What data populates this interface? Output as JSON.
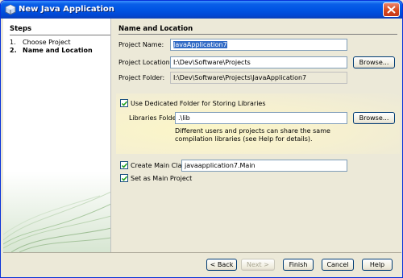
{
  "window": {
    "title": "New Java Application"
  },
  "steps": {
    "title": "Steps",
    "items": [
      {
        "num": "1.",
        "label": "Choose Project"
      },
      {
        "num": "2.",
        "label": "Name and Location"
      }
    ]
  },
  "main": {
    "title": "Name and Location",
    "project_name_label": "Project Name:",
    "project_name_value": "JavaApplication7",
    "project_location_label": "Project Location:",
    "project_location_value": "I:\\Dev\\Software\\Projects",
    "browse_label": "Browse...",
    "project_folder_label": "Project Folder:",
    "project_folder_value": "I:\\Dev\\Software\\Projects\\JavaApplication7",
    "use_dedicated_folder_label": "Use Dedicated Folder for Storing Libraries",
    "use_dedicated_folder_checked": true,
    "libraries_folder_label": "Libraries Folder:",
    "libraries_folder_value": ".\\lib",
    "libraries_note": "Different users and projects can share the same compilation libraries (see Help for details).",
    "create_main_class_label": "Create Main Class",
    "create_main_class_checked": true,
    "main_class_value": "javaapplication7.Main",
    "set_as_main_label": "Set as Main Project",
    "set_as_main_checked": true
  },
  "buttons": {
    "back": "< Back",
    "next": "Next >",
    "finish": "Finish",
    "cancel": "Cancel",
    "help": "Help"
  },
  "colors": {
    "title_bar": "#0054e3",
    "selection": "#316ac5",
    "dialog_bg": "#ece9d8"
  }
}
